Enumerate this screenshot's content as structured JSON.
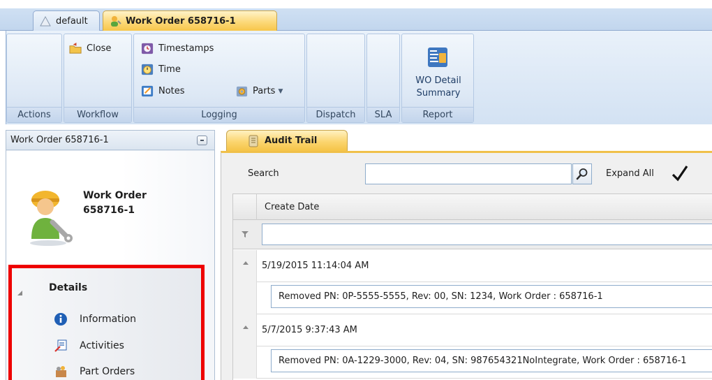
{
  "tabs": [
    {
      "label": "default",
      "icon": "home-arrow-icon"
    },
    {
      "label": "Work Order 658716-1",
      "icon": "worker-icon"
    }
  ],
  "ribbon": {
    "groups": {
      "actions": "Actions",
      "workflow": "Workflow",
      "logging": "Logging",
      "dispatch": "Dispatch",
      "sla": "SLA",
      "report": "Report"
    },
    "buttons": {
      "close": "Close",
      "timestamps": "Timestamps",
      "time": "Time",
      "notes": "Notes",
      "parts": "Parts",
      "wo_detail_line1": "WO Detail",
      "wo_detail_line2": "Summary"
    }
  },
  "left_panel": {
    "header": "Work Order 658716-1",
    "title_line1": "Work Order",
    "title_line2": "658716-1",
    "section_title": "Details",
    "items": [
      {
        "label": "Information",
        "icon": "info-icon"
      },
      {
        "label": "Activities",
        "icon": "activities-icon"
      },
      {
        "label": "Part Orders",
        "icon": "part-orders-icon"
      }
    ]
  },
  "content": {
    "tab_label": "Audit Trail",
    "search_label": "Search",
    "search_value": "",
    "expand_all_label": "Expand All",
    "expand_all_checked": true,
    "column_header": "Create Date",
    "filter_value": "",
    "groups": [
      {
        "date": "5/19/2015 11:14:04 AM",
        "detail": "Removed PN: 0P-5555-5555, Rev: 00, SN: 1234, Work Order : 658716-1"
      },
      {
        "date": "5/7/2015 9:37:43 AM",
        "detail": "Removed PN: 0A-1229-3000, Rev: 04, SN: 987654321NoIntegrate, Work Order : 658716-1"
      }
    ]
  },
  "colors": {
    "accent_orange": "#f7c64a",
    "ribbon_blue": "#d3e2f3",
    "highlight_red": "#ee0000"
  }
}
